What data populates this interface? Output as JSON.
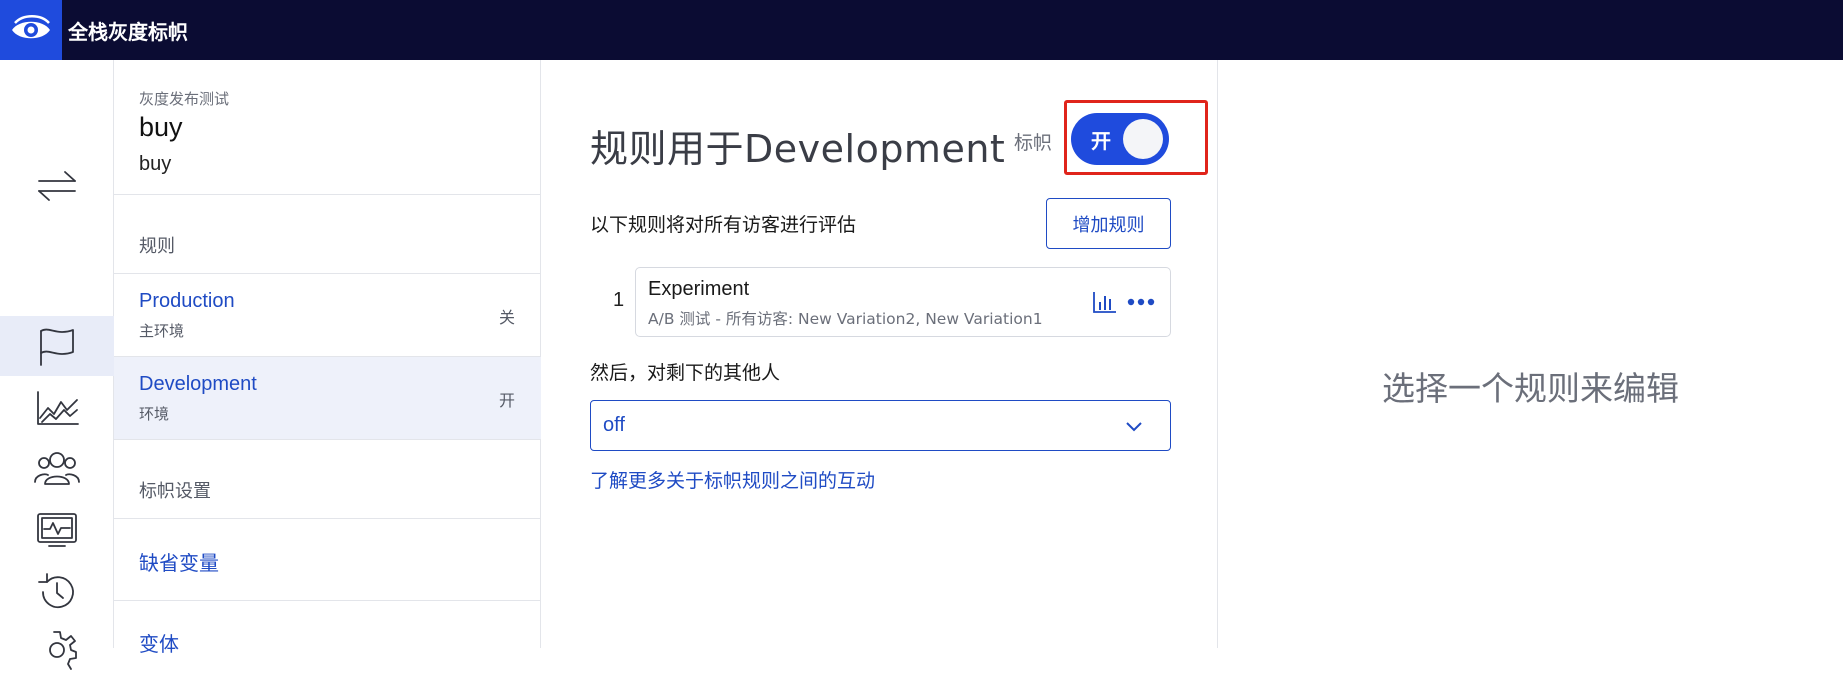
{
  "app": {
    "title": "全栈灰度标帜"
  },
  "rail": {
    "items": [
      {
        "icon": "switch-arrows-icon"
      },
      {
        "icon": "flag-icon",
        "active": true
      },
      {
        "icon": "line-chart-icon"
      },
      {
        "icon": "users-icon"
      },
      {
        "icon": "monitor-pulse-icon"
      },
      {
        "icon": "history-icon"
      },
      {
        "icon": "gear-icon"
      }
    ]
  },
  "flag_panel": {
    "project": "灰度发布测试",
    "flag_name": "buy",
    "flag_key": "buy",
    "rules_section": "规则",
    "environments": [
      {
        "name": "Production",
        "desc": "主环境",
        "state": "关",
        "active": false
      },
      {
        "name": "Development",
        "desc": "环境",
        "state": "开",
        "active": true
      }
    ],
    "settings_section": "标帜设置",
    "links": [
      {
        "label": "缺省变量"
      },
      {
        "label": "变体"
      }
    ]
  },
  "main": {
    "heading": "规则用于Development",
    "toggle_label": "标帜",
    "toggle_state": "开",
    "eval_text": "以下规则将对所有访客进行评估",
    "add_rule_label": "增加规则",
    "rules": [
      {
        "index": "1",
        "title": "Experiment",
        "subtitle": "A/B 测试 - 所有访客: New Variation2, New Variation1"
      }
    ],
    "fallthrough_text": "然后，对剩下的其他人",
    "fallthrough_value": "off",
    "learn_more": "了解更多关于标帜规则之间的互动"
  },
  "right_panel": {
    "empty_text": "选择一个规则来编辑"
  },
  "colors": {
    "topbar": "#0b0c33",
    "accent": "#1f4bdd",
    "link": "#1f4bc4",
    "highlight": "#e0241b"
  }
}
